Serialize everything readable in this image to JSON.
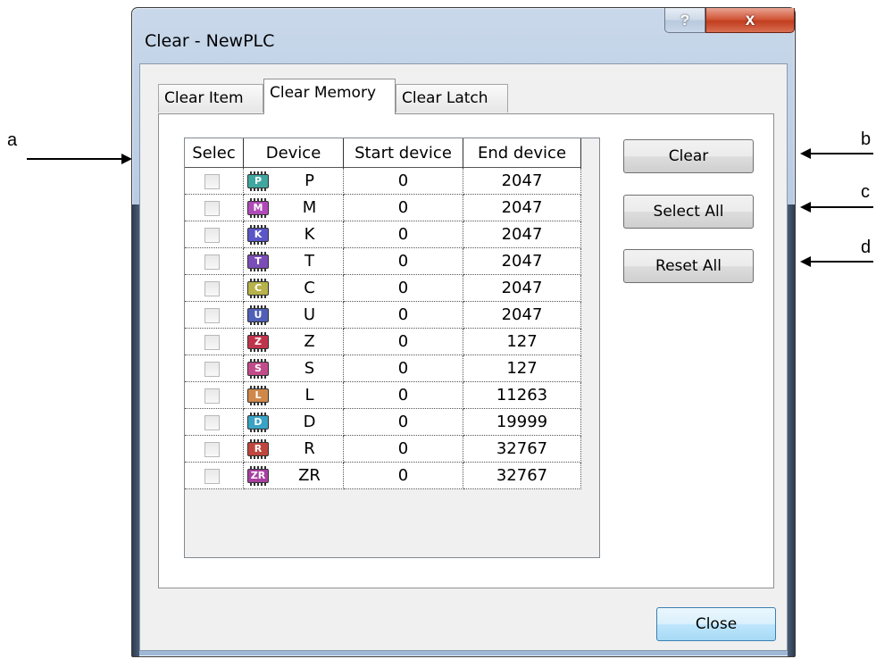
{
  "callouts": {
    "a": "a",
    "b": "b",
    "c": "c",
    "d": "d"
  },
  "window": {
    "title": "Clear - NewPLC",
    "help_label": "?",
    "close_label": "x"
  },
  "tabs": [
    {
      "label": "Clear Item"
    },
    {
      "label": "Clear Memory",
      "active": true
    },
    {
      "label": "Clear Latch"
    }
  ],
  "table": {
    "columns": [
      "Selec",
      "Device",
      "Start device",
      "End device"
    ],
    "rows": [
      {
        "device": "P",
        "icon_color": "#3fa6a0",
        "icon_glyph": "P",
        "start": "0",
        "end": "2047"
      },
      {
        "device": "M",
        "icon_color": "#b04ab8",
        "icon_glyph": "M",
        "start": "0",
        "end": "2047"
      },
      {
        "device": "K",
        "icon_color": "#5a56c8",
        "icon_glyph": "K",
        "start": "0",
        "end": "2047"
      },
      {
        "device": "T",
        "icon_color": "#7a4db8",
        "icon_glyph": "T",
        "start": "0",
        "end": "2047"
      },
      {
        "device": "C",
        "icon_color": "#b7b24a",
        "icon_glyph": "C",
        "start": "0",
        "end": "2047"
      },
      {
        "device": "U",
        "icon_color": "#4f5fb8",
        "icon_glyph": "U",
        "start": "0",
        "end": "2047"
      },
      {
        "device": "Z",
        "icon_color": "#c0344b",
        "icon_glyph": "Z",
        "start": "0",
        "end": "127"
      },
      {
        "device": "S",
        "icon_color": "#c24c8a",
        "icon_glyph": "S",
        "start": "0",
        "end": "127"
      },
      {
        "device": "L",
        "icon_color": "#d0884a",
        "icon_glyph": "L",
        "start": "0",
        "end": "11263"
      },
      {
        "device": "D",
        "icon_color": "#3aa2c4",
        "icon_glyph": "D",
        "start": "0",
        "end": "19999"
      },
      {
        "device": "R",
        "icon_color": "#c0463d",
        "icon_glyph": "R",
        "start": "0",
        "end": "32767"
      },
      {
        "device": "ZR",
        "icon_color": "#a83fa0",
        "icon_glyph": "ZR",
        "start": "0",
        "end": "32767"
      }
    ]
  },
  "buttons": {
    "clear": "Clear",
    "select_all": "Select All",
    "reset_all": "Reset All",
    "close": "Close"
  }
}
